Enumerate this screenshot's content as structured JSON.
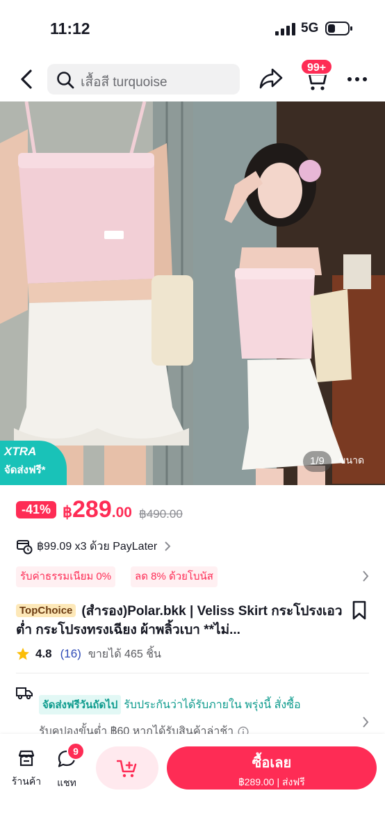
{
  "status_bar": {
    "time": "11:12",
    "network": "5G"
  },
  "header": {
    "search_text": "เสื้อสี turquoise",
    "cart_badge": "99+"
  },
  "gallery": {
    "xtra_title": "XTRA",
    "xtra_subtitle": "จัดส่งฟรี*",
    "counter": "1/9",
    "size_label": "ขนาด"
  },
  "price": {
    "discount": "-41%",
    "currency": "฿",
    "main": "289",
    "decimal": ".00",
    "old_price": "฿490.00"
  },
  "paylater": {
    "text": "฿99.09 x3 ด้วย PayLater"
  },
  "promos": [
    "รับค่าธรรมเนียม 0%",
    "ลด 8% ด้วยโบนัส"
  ],
  "product": {
    "badge": "TopChoice",
    "title": "(สำรอง)Polar.bkk | Veliss Skirt กระโปรงเอวต่ำ กระโปรงทรงเฉียง  ผ้าพลิ้วเบา **ไม่...",
    "rating": "4.8",
    "review_count": "(16)",
    "sold": "ขายได้ 465 ชิ้น"
  },
  "shipping": {
    "tag": "จัดส่งฟรีวันถัดไป",
    "text": "รับประกันว่าได้รับภายใน พรุ่งนี้ สั่งซื้อ",
    "coupon": "รับคูปองขั้นต่ำ ฿60 หากได้รับสินค้าล่าช้า"
  },
  "bottom_bar": {
    "store_label": "ร้านค้า",
    "chat_label": "แชท",
    "chat_badge": "9",
    "buy_label": "ซื้อเลย",
    "buy_sub": "฿289.00 | ส่งฟรี"
  },
  "colors": {
    "accent": "#fe2c55",
    "teal": "#19c2b8",
    "shipping_text": "#0d9b8d"
  }
}
